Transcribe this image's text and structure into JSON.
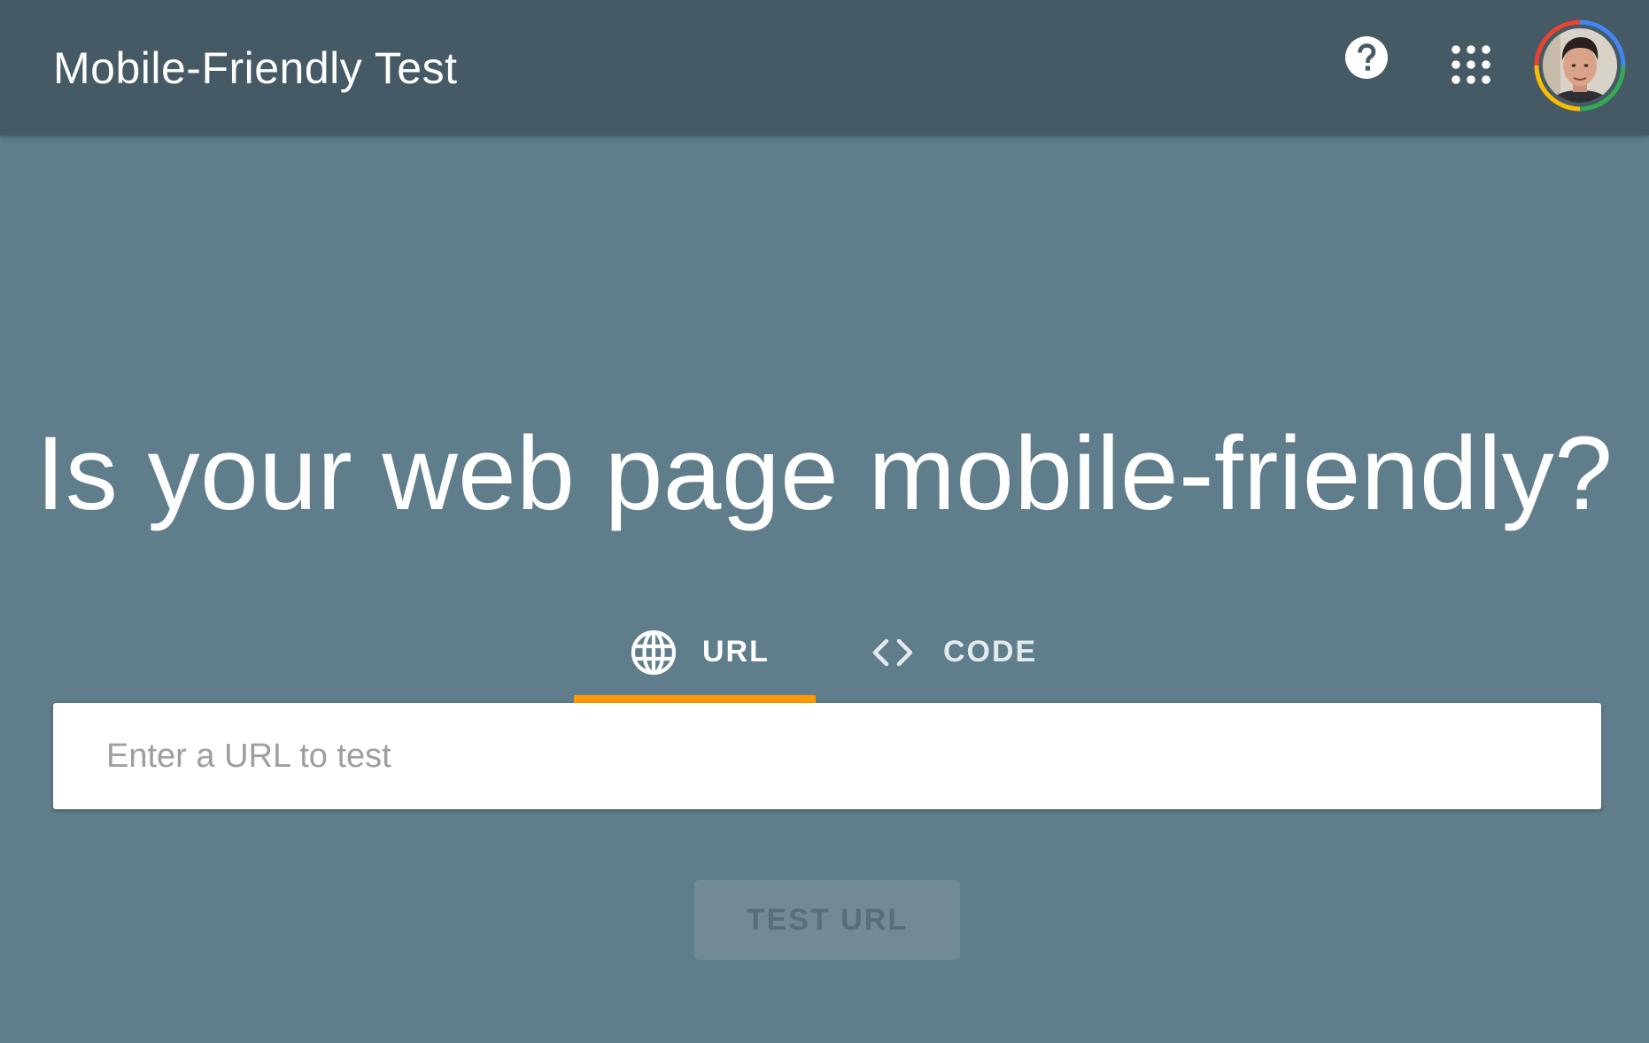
{
  "header": {
    "title": "Mobile-Friendly Test",
    "help_icon": "help-circle-icon",
    "apps_icon": "apps-grid-icon",
    "avatar": "account-avatar"
  },
  "hero": {
    "title": "Is your web page mobile-friendly?"
  },
  "tabs": [
    {
      "label": "URL",
      "icon": "globe-icon",
      "active": true
    },
    {
      "label": "CODE",
      "icon": "code-brackets-icon",
      "active": false
    }
  ],
  "url_input": {
    "placeholder": "Enter a URL to test",
    "value": ""
  },
  "test_button": {
    "label": "TEST URL",
    "enabled": false
  },
  "colors": {
    "background": "#607d8b",
    "header": "#455a64",
    "tab_indicator": "#ff9800",
    "button_disabled": "#718a96"
  }
}
